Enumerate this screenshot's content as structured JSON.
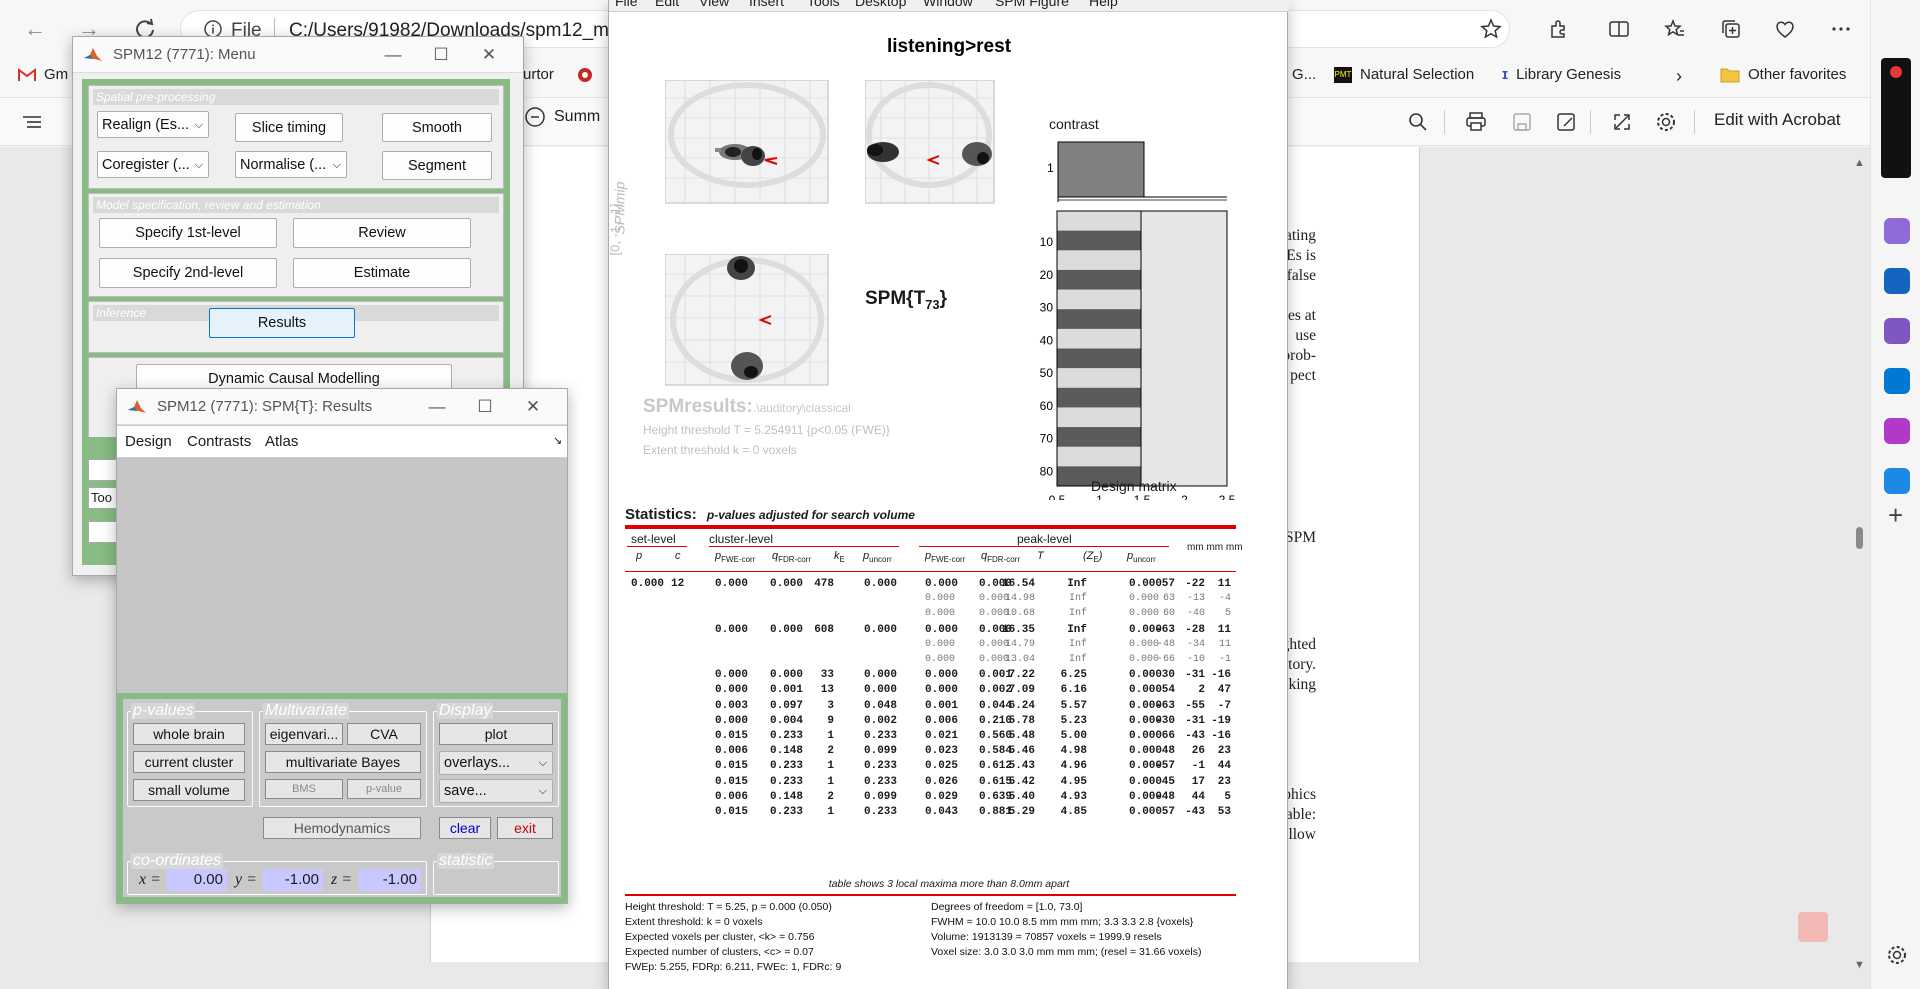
{
  "browser": {
    "address_prefix": "File",
    "address_url": "C:/Users/91982/Downloads/spm12_manu",
    "bookmarks": [
      "Gm",
      "rurtor",
      "G...",
      "Natural Selection",
      "Library Genesis",
      "Other favorites"
    ],
    "summ_tab": "Summ",
    "acrobat_label": "Edit with Acrobat",
    "pdf_text": [
      "ating",
      "Es is",
      "false",
      "es at",
      "use",
      "prob-",
      "pect",
      "SPM",
      "ghted",
      "ctory.",
      "king",
      "phics",
      "able:",
      "allow"
    ]
  },
  "menu_window": {
    "title": "SPM12 (7771): Menu",
    "spatial": {
      "header": "Spatial pre-processing",
      "realign": "Realign (Es...",
      "slice_timing": "Slice timing",
      "smooth": "Smooth",
      "coregister": "Coregister (...",
      "normalise": "Normalise (...",
      "segment": "Segment"
    },
    "model": {
      "header": "Model specification, review and estimation",
      "specify_1st": "Specify 1st-level",
      "review": "Review",
      "specify_2nd": "Specify 2nd-level",
      "estimate": "Estimate"
    },
    "inference": {
      "header": "Inference",
      "results": "Results"
    },
    "dcm": "Dynamic Causal Modelling",
    "toolbox_partial": "Too"
  },
  "results_window": {
    "title": "SPM12 (7771): SPM{T}: Results",
    "menu": [
      "Design",
      "Contrasts",
      "Atlas"
    ],
    "pvalues": {
      "label": "p-values",
      "whole_brain": "whole brain",
      "current_cluster": "current cluster",
      "small_volume": "small volume"
    },
    "multivariate": {
      "label": "Multivariate",
      "eigenvariate": "eigenvari...",
      "cva": "CVA",
      "bayes": "multivariate Bayes",
      "bms": "BMS",
      "pvalue": "p-value"
    },
    "display": {
      "label": "Display",
      "plot": "plot",
      "overlays": "overlays...",
      "save": "save..."
    },
    "hemodynamics": "Hemodynamics",
    "clear": "clear",
    "exit": "exit",
    "coords": {
      "label": "co-ordinates",
      "x_label": "x =",
      "x": "0.00",
      "y_label": "y =",
      "y": "-1.00",
      "z_label": "z =",
      "z": "-1.00"
    },
    "statistic_label": "statistic"
  },
  "figure": {
    "menu": [
      "File",
      "Edit",
      "View",
      "Insert",
      "Tools",
      "Desktop",
      "Window",
      "SPM Figure",
      "Help"
    ],
    "title": "listening>rest",
    "mip_label": "SPMmip",
    "mip_coords": "[0, -1, -1]",
    "spm_stat": "SPM{T",
    "spm_df": "73",
    "results_title": "SPMresults:",
    "results_path": ".\\auditory\\classical",
    "height_threshold": "Height threshold T = 5.254911  {p<0.05 (FWE)}",
    "extent_threshold": "Extent threshold k = 0 voxels",
    "contrast_label": "contrast",
    "design_label": "Design matrix",
    "dm_y_ticks": [
      "10",
      "20",
      "30",
      "40",
      "50",
      "60",
      "70",
      "80"
    ],
    "dm_x_ticks": [
      "0.5",
      "1",
      "1.5",
      "2",
      "2.5"
    ],
    "contrast_tick": "1",
    "stats_label": "Statistics:",
    "stats_sub": "p-values adjusted for search volume",
    "hdr_set": "set-level",
    "hdr_cluster": "cluster-level",
    "hdr_peak": "peak-level",
    "hdr_mm": "mm mm mm",
    "cols": {
      "p": "p",
      "c": "c",
      "pfwe": "p",
      "pfwe_sub": "FWE-corr",
      "qfdr": "q",
      "qfdr_sub": "FDR-corr",
      "ke": "k",
      "ke_sub": "E",
      "punc": "p",
      "punc_sub": "uncorr",
      "ppfwe": "p",
      "ppfwe_sub": "FWE-corr",
      "pqfdr": "q",
      "pqfdr_sub": "FDR-corr",
      "T": "T",
      "ze": "(Z",
      "ze_sub": "E",
      "ze_close": ")",
      "ppunc": "p",
      "ppunc_sub": "uncorr"
    },
    "rows": [
      {
        "set_p": "0.000",
        "set_c": "12",
        "cl_pfwe": "0.000",
        "cl_qfdr": "0.000",
        "ke": "478",
        "cl_punc": "0.000",
        "pk_pfwe": "0.000",
        "pk_qfdr": "0.000",
        "T": "16.54",
        "ZE": "Inf",
        "pk_punc": "0.000",
        "x": "57",
        "y": "-22",
        "z": "11",
        "sub": false
      },
      {
        "set_p": "",
        "set_c": "",
        "cl_pfwe": "",
        "cl_qfdr": "",
        "ke": "",
        "cl_punc": "",
        "pk_pfwe": "0.000",
        "pk_qfdr": "0.000",
        "T": "14.98",
        "ZE": "Inf",
        "pk_punc": "0.000",
        "x": "63",
        "y": "-13",
        "z": "-4",
        "sub": true
      },
      {
        "set_p": "",
        "set_c": "",
        "cl_pfwe": "",
        "cl_qfdr": "",
        "ke": "",
        "cl_punc": "",
        "pk_pfwe": "0.000",
        "pk_qfdr": "0.000",
        "T": "10.68",
        "ZE": "Inf",
        "pk_punc": "0.000",
        "x": "60",
        "y": "-40",
        "z": "5",
        "sub": true
      },
      {
        "set_p": "",
        "set_c": "",
        "cl_pfwe": "0.000",
        "cl_qfdr": "0.000",
        "ke": "608",
        "cl_punc": "0.000",
        "pk_pfwe": "0.000",
        "pk_qfdr": "0.000",
        "T": "16.35",
        "ZE": "Inf",
        "pk_punc": "0.000",
        "x": "-63",
        "y": "-28",
        "z": "11",
        "sub": false
      },
      {
        "set_p": "",
        "set_c": "",
        "cl_pfwe": "",
        "cl_qfdr": "",
        "ke": "",
        "cl_punc": "",
        "pk_pfwe": "0.000",
        "pk_qfdr": "0.000",
        "T": "14.79",
        "ZE": "Inf",
        "pk_punc": "0.000",
        "x": "-48",
        "y": "-34",
        "z": "11",
        "sub": true
      },
      {
        "set_p": "",
        "set_c": "",
        "cl_pfwe": "",
        "cl_qfdr": "",
        "ke": "",
        "cl_punc": "",
        "pk_pfwe": "0.000",
        "pk_qfdr": "0.000",
        "T": "13.04",
        "ZE": "Inf",
        "pk_punc": "0.000",
        "x": "-66",
        "y": "-10",
        "z": "-1",
        "sub": true
      },
      {
        "set_p": "",
        "set_c": "",
        "cl_pfwe": "0.000",
        "cl_qfdr": "0.000",
        "ke": "33",
        "cl_punc": "0.000",
        "pk_pfwe": "0.000",
        "pk_qfdr": "0.001",
        "T": "7.22",
        "ZE": "6.25",
        "pk_punc": "0.000",
        "x": "30",
        "y": "-31",
        "z": "-16",
        "sub": false
      },
      {
        "set_p": "",
        "set_c": "",
        "cl_pfwe": "0.000",
        "cl_qfdr": "0.001",
        "ke": "13",
        "cl_punc": "0.000",
        "pk_pfwe": "0.000",
        "pk_qfdr": "0.002",
        "T": "7.09",
        "ZE": "6.16",
        "pk_punc": "0.000",
        "x": "54",
        "y": "2",
        "z": "47",
        "sub": false
      },
      {
        "set_p": "",
        "set_c": "",
        "cl_pfwe": "0.003",
        "cl_qfdr": "0.097",
        "ke": "3",
        "cl_punc": "0.048",
        "pk_pfwe": "0.001",
        "pk_qfdr": "0.044",
        "T": "6.24",
        "ZE": "5.57",
        "pk_punc": "0.000",
        "x": "-63",
        "y": "-55",
        "z": "-7",
        "sub": false
      },
      {
        "set_p": "",
        "set_c": "",
        "cl_pfwe": "0.000",
        "cl_qfdr": "0.004",
        "ke": "9",
        "cl_punc": "0.002",
        "pk_pfwe": "0.006",
        "pk_qfdr": "0.210",
        "T": "5.78",
        "ZE": "5.23",
        "pk_punc": "0.000",
        "x": "-30",
        "y": "-31",
        "z": "-19",
        "sub": false
      },
      {
        "set_p": "",
        "set_c": "",
        "cl_pfwe": "0.015",
        "cl_qfdr": "0.233",
        "ke": "1",
        "cl_punc": "0.233",
        "pk_pfwe": "0.021",
        "pk_qfdr": "0.560",
        "T": "5.48",
        "ZE": "5.00",
        "pk_punc": "0.000",
        "x": "66",
        "y": "-43",
        "z": "-16",
        "sub": false
      },
      {
        "set_p": "",
        "set_c": "",
        "cl_pfwe": "0.006",
        "cl_qfdr": "0.148",
        "ke": "2",
        "cl_punc": "0.099",
        "pk_pfwe": "0.023",
        "pk_qfdr": "0.584",
        "T": "5.46",
        "ZE": "4.98",
        "pk_punc": "0.000",
        "x": "48",
        "y": "26",
        "z": "23",
        "sub": false
      },
      {
        "set_p": "",
        "set_c": "",
        "cl_pfwe": "0.015",
        "cl_qfdr": "0.233",
        "ke": "1",
        "cl_punc": "0.233",
        "pk_pfwe": "0.025",
        "pk_qfdr": "0.612",
        "T": "5.43",
        "ZE": "4.96",
        "pk_punc": "0.000",
        "x": "-57",
        "y": "-1",
        "z": "44",
        "sub": false
      },
      {
        "set_p": "",
        "set_c": "",
        "cl_pfwe": "0.015",
        "cl_qfdr": "0.233",
        "ke": "1",
        "cl_punc": "0.233",
        "pk_pfwe": "0.026",
        "pk_qfdr": "0.615",
        "T": "5.42",
        "ZE": "4.95",
        "pk_punc": "0.000",
        "x": "45",
        "y": "17",
        "z": "23",
        "sub": false
      },
      {
        "set_p": "",
        "set_c": "",
        "cl_pfwe": "0.006",
        "cl_qfdr": "0.148",
        "ke": "2",
        "cl_punc": "0.099",
        "pk_pfwe": "0.029",
        "pk_qfdr": "0.639",
        "T": "5.40",
        "ZE": "4.93",
        "pk_punc": "0.000",
        "x": "-48",
        "y": "44",
        "z": "5",
        "sub": false
      },
      {
        "set_p": "",
        "set_c": "",
        "cl_pfwe": "0.015",
        "cl_qfdr": "0.233",
        "ke": "1",
        "cl_punc": "0.233",
        "pk_pfwe": "0.043",
        "pk_qfdr": "0.881",
        "T": "5.29",
        "ZE": "4.85",
        "pk_punc": "0.000",
        "x": "57",
        "y": "-43",
        "z": "53",
        "sub": false
      }
    ],
    "table_note": "table shows 3 local maxima more than 8.0mm apart",
    "footer_left": [
      "Height threshold: T = 5.25, p = 0.000 (0.050)",
      "Extent threshold: k = 0 voxels",
      "Expected voxels per cluster, <k> = 0.756",
      "Expected number of clusters, <c> = 0.07",
      "FWEp: 5.255, FDRp: 6.211, FWEc: 1, FDRc: 9"
    ],
    "footer_right": [
      "Degrees of freedom = [1.0, 73.0]",
      "FWHM = 10.0 10.0 8.5 mm mm mm; 3.3 3.3 2.8 {voxels}",
      "Volume: 1913139 = 70857 voxels = 1999.9 resels",
      "Voxel size: 3.0 3.0 3.0 mm mm mm; (resel = 31.66 voxels)"
    ]
  }
}
